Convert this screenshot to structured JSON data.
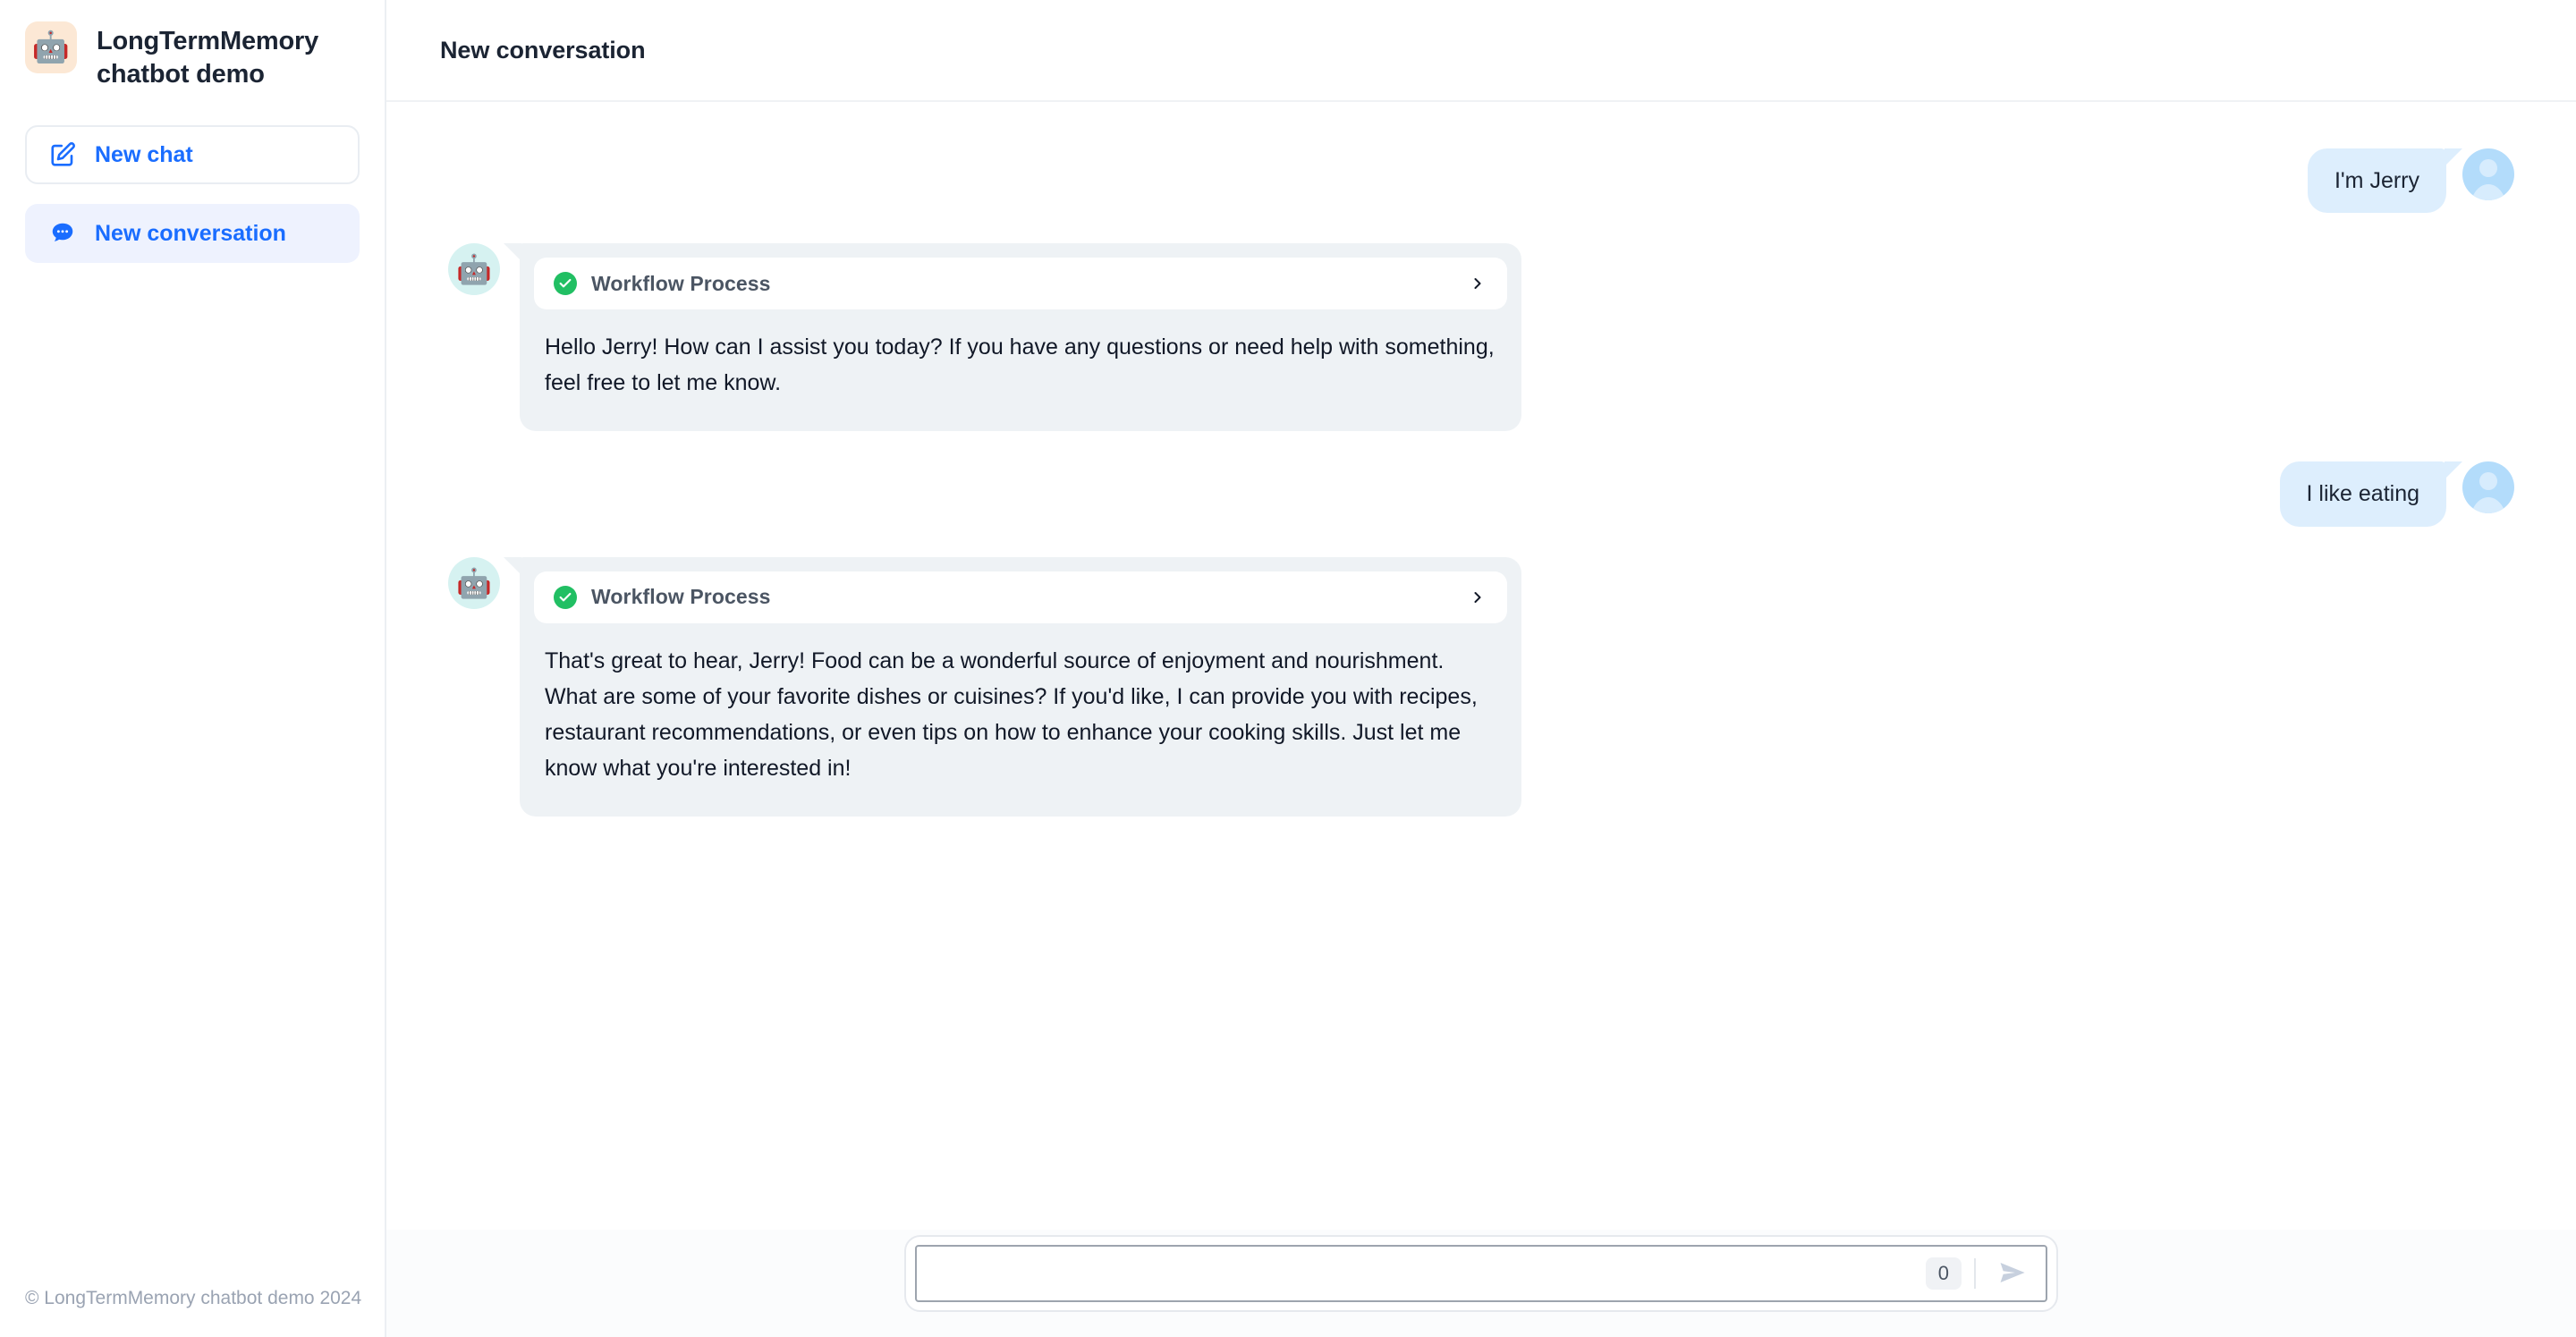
{
  "sidebar": {
    "logo_icon": "robot-emoji",
    "logo_glyph": "🤖",
    "title": "LongTermMemory chatbot demo",
    "new_chat": {
      "label": "New chat",
      "icon": "compose-edit-icon"
    },
    "conversations": [
      {
        "label": "New conversation",
        "icon": "chat-bubble-dots-icon",
        "active": true
      }
    ],
    "footer": "© LongTermMemory chatbot demo 2024"
  },
  "header": {
    "title": "New conversation"
  },
  "conversation": {
    "messages": [
      {
        "role": "user",
        "text": "I'm Jerry",
        "avatar_icon": "user-avatar-icon"
      },
      {
        "role": "bot",
        "avatar_icon": "robot-emoji",
        "avatar_glyph": "🤖",
        "workflow": {
          "label": "Workflow Process",
          "status_icon": "green-check-circle-icon",
          "expand_icon": "chevron-right-icon"
        },
        "text": "Hello Jerry! How can I assist you today? If you have any questions or need help with something, feel free to let me know."
      },
      {
        "role": "user",
        "text": "I like eating",
        "avatar_icon": "user-avatar-icon"
      },
      {
        "role": "bot",
        "avatar_icon": "robot-emoji",
        "avatar_glyph": "🤖",
        "workflow": {
          "label": "Workflow Process",
          "status_icon": "green-check-circle-icon",
          "expand_icon": "chevron-right-icon"
        },
        "text": "That's great to hear, Jerry! Food can be a wonderful source of enjoyment and nourishment. What are some of your favorite dishes or cuisines? If you'd like, I can provide you with recipes, restaurant recommendations, or even tips on how to enhance your cooking skills. Just let me know what you're interested in!"
      }
    ]
  },
  "composer": {
    "value": "",
    "placeholder": "",
    "char_count": "0",
    "send_icon": "send-paper-plane-icon"
  },
  "colors": {
    "accent": "#1a6dff",
    "user_bubble": "#ddeefd",
    "bot_bubble": "#eef2f5",
    "status_green": "#21bf63",
    "logo_tile": "#fce8d5",
    "bot_avatar": "#d6f2f1",
    "sidebar_active": "#eef2fe"
  }
}
